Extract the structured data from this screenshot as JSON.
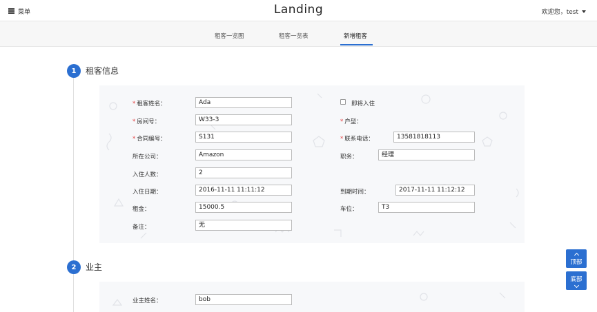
{
  "header": {
    "menu_label": "菜单",
    "brand": "Landing",
    "user_greeting": "欢迎您，test"
  },
  "tabs": [
    {
      "label": "租客一览图"
    },
    {
      "label": "租客一览表"
    },
    {
      "label": "新增租客",
      "active": true
    }
  ],
  "sections": {
    "tenant": {
      "step": "1",
      "title": "租客信息",
      "fields": {
        "name": {
          "label": "租客姓名：",
          "required": true,
          "value": "Ada"
        },
        "move_in_soon": {
          "label": "即将入住",
          "checked": false
        },
        "room": {
          "label": "房间号：",
          "required": true,
          "value": "W33-3"
        },
        "unit_type": {
          "label": "户型：",
          "required": true,
          "value": ""
        },
        "contract": {
          "label": "合同编号：",
          "required": true,
          "value": "S131"
        },
        "phone": {
          "label": "联系电话：",
          "required": true,
          "value": "13581818113"
        },
        "company": {
          "label": "所在公司：",
          "value": "Amazon"
        },
        "position": {
          "label": "职务：",
          "value": "经理"
        },
        "occupants": {
          "label": "入住人数：",
          "value": "2"
        },
        "move_in_date": {
          "label": "入住日期：",
          "value": "2016-11-11 11:11:12"
        },
        "expiry": {
          "label": "到期时间：",
          "value": "2017-11-11 11:12:12"
        },
        "rent": {
          "label": "租金：",
          "value": "15000.5"
        },
        "parking": {
          "label": "车位：",
          "value": "T3"
        },
        "remark": {
          "label": "备注：",
          "value": "无"
        }
      }
    },
    "owner": {
      "step": "2",
      "title": "业主",
      "fields": {
        "owner_name": {
          "label": "业主姓名：",
          "value": "bob"
        }
      }
    }
  },
  "side_buttons": {
    "top": "顶部",
    "bottom": "底部"
  },
  "colors": {
    "accent": "#2b6fd1",
    "required": "#e23c3c",
    "panel_bg": "#f7f8fa"
  }
}
